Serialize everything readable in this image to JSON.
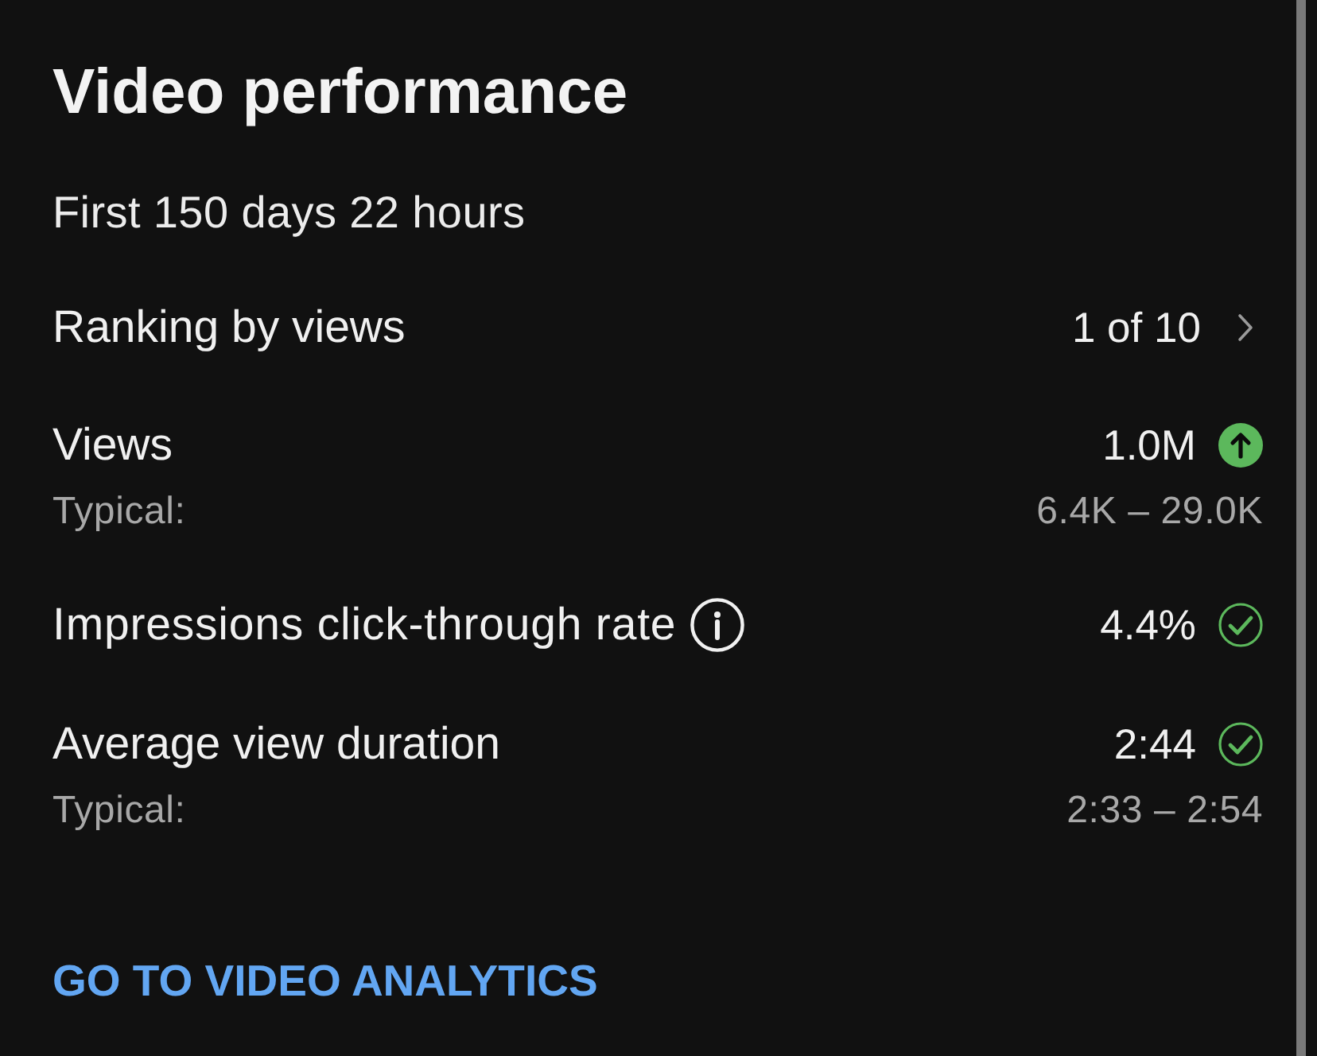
{
  "card": {
    "title": "Video performance",
    "period": "First 150 days 22 hours"
  },
  "rows": [
    {
      "kind": "link",
      "label": "Ranking by views",
      "value": "1 of 10"
    },
    {
      "kind": "metric",
      "label": "Views",
      "info": false,
      "value": "1.0M",
      "above_typical": true,
      "typical_label": "Typical:",
      "typical_range": "6.4K – 29.0K"
    },
    {
      "kind": "metric",
      "label": "Impressions click-through rate",
      "info": true,
      "value": "4.4%",
      "above_typical": false
    },
    {
      "kind": "metric",
      "label": "Average view duration",
      "info": false,
      "value": "2:44",
      "above_typical": false,
      "typical_label": "Typical:",
      "typical_range": "2:33 – 2:54"
    }
  ],
  "action": {
    "label": "GO TO VIDEO ANALYTICS"
  }
}
